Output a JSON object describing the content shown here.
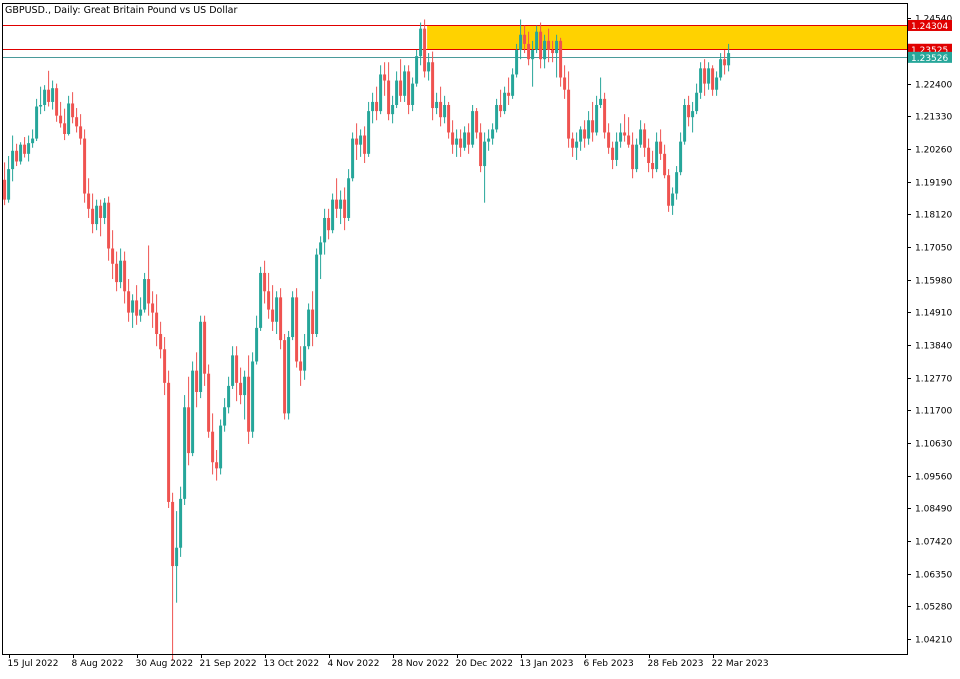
{
  "header": {
    "symbol": "GBPUSD.",
    "timeframe": "Daily",
    "description": "Great Britain Pound vs US Dollar"
  },
  "chart_data": {
    "type": "candlestick",
    "symbol": "GBPUSD.",
    "timeframe": "Daily",
    "ylim": [
      1.0372,
      1.2504
    ],
    "y_ticks": [
      "1.24540",
      "1.22400",
      "1.21330",
      "1.20260",
      "1.19190",
      "1.18120",
      "1.17050",
      "1.15980",
      "1.14910",
      "1.13840",
      "1.12770",
      "1.11700",
      "1.10630",
      "1.09560",
      "1.08490",
      "1.07420",
      "1.06350",
      "1.05280",
      "1.04210"
    ],
    "x_tick_labels": [
      "15 Jul 2022",
      "8 Aug 2022",
      "30 Aug 2022",
      "21 Sep 2022",
      "13 Oct 2022",
      "4 Nov 2022",
      "28 Nov 2022",
      "20 Dec 2022",
      "13 Jan 2023",
      "6 Feb 2023",
      "28 Feb 2023",
      "22 Mar 2023"
    ],
    "x_tick_index": [
      1,
      17,
      33,
      49,
      65,
      81,
      97,
      113,
      129,
      145,
      161,
      177
    ],
    "up_color": "#26a69a",
    "down_color": "#ef5350",
    "grid": false,
    "price_labels": [
      {
        "text": "1.24304",
        "value": 1.24304,
        "bg": "#e00000",
        "fg": "#ffffff"
      },
      {
        "text": "1.23525",
        "value": 1.23525,
        "bg": "#e00000",
        "fg": "#ffffff"
      },
      {
        "text": "1.23526",
        "value": 1.2326,
        "bg": "#26a69a",
        "fg": "#ffffff"
      }
    ],
    "horizontal_lines": [
      {
        "value": 1.24304,
        "color": "#e00000"
      },
      {
        "value": 1.23525,
        "color": "#e00000"
      },
      {
        "value": 1.2326,
        "color": "#4a9a9a"
      }
    ],
    "zone": {
      "from_index": 106,
      "y_top": 1.24304,
      "y_bottom": 1.23525,
      "color": "#ffd200"
    },
    "candles": [
      [
        1.1925,
        1.1982,
        1.1842,
        1.186
      ],
      [
        1.186,
        1.2003,
        1.185,
        1.196
      ],
      [
        1.196,
        1.207,
        1.192,
        1.202
      ],
      [
        1.202,
        1.2043,
        1.197,
        1.1985
      ],
      [
        1.1985,
        1.2048,
        1.1975,
        1.204
      ],
      [
        1.204,
        1.2065,
        1.1998,
        1.201
      ],
      [
        1.201,
        1.207,
        1.1985,
        1.2045
      ],
      [
        1.2045,
        1.209,
        1.203,
        1.206
      ],
      [
        1.206,
        1.219,
        1.2052,
        1.2165
      ],
      [
        1.2165,
        1.223,
        1.214,
        1.217
      ],
      [
        1.217,
        1.2235,
        1.215,
        1.222
      ],
      [
        1.222,
        1.2282,
        1.2165,
        1.218
      ],
      [
        1.218,
        1.225,
        1.2155,
        1.2225
      ],
      [
        1.2225,
        1.224,
        1.2115,
        1.2135
      ],
      [
        1.2135,
        1.218,
        1.2096,
        1.211
      ],
      [
        1.211,
        1.2158,
        1.2055,
        1.2075
      ],
      [
        1.2075,
        1.22,
        1.207,
        1.2175
      ],
      [
        1.2175,
        1.2212,
        1.211,
        1.213
      ],
      [
        1.213,
        1.216,
        1.208,
        1.21
      ],
      [
        1.21,
        1.214,
        1.204,
        1.206
      ],
      [
        1.206,
        1.209,
        1.185,
        1.188
      ],
      [
        1.188,
        1.193,
        1.18,
        1.183
      ],
      [
        1.183,
        1.188,
        1.175,
        1.178
      ],
      [
        1.178,
        1.186,
        1.176,
        1.184
      ],
      [
        1.184,
        1.186,
        1.174,
        1.18
      ],
      [
        1.18,
        1.1865,
        1.178,
        1.185
      ],
      [
        1.185,
        1.187,
        1.166,
        1.17
      ],
      [
        1.17,
        1.176,
        1.16,
        1.165
      ],
      [
        1.165,
        1.169,
        1.156,
        1.159
      ],
      [
        1.159,
        1.17,
        1.157,
        1.166
      ],
      [
        1.166,
        1.169,
        1.152,
        1.156
      ],
      [
        1.156,
        1.16,
        1.146,
        1.149
      ],
      [
        1.149,
        1.155,
        1.144,
        1.153
      ],
      [
        1.153,
        1.158,
        1.145,
        1.148
      ],
      [
        1.148,
        1.154,
        1.146,
        1.15
      ],
      [
        1.15,
        1.162,
        1.149,
        1.16
      ],
      [
        1.16,
        1.171,
        1.148,
        1.152
      ],
      [
        1.152,
        1.156,
        1.144,
        1.149
      ],
      [
        1.149,
        1.155,
        1.138,
        1.142
      ],
      [
        1.142,
        1.146,
        1.134,
        1.137
      ],
      [
        1.137,
        1.141,
        1.122,
        1.126
      ],
      [
        1.126,
        1.13,
        1.085,
        1.087
      ],
      [
        1.087,
        1.09,
        1.035,
        1.066
      ],
      [
        1.066,
        1.084,
        1.054,
        1.072
      ],
      [
        1.072,
        1.092,
        1.069,
        1.088
      ],
      [
        1.088,
        1.122,
        1.086,
        1.118
      ],
      [
        1.118,
        1.128,
        1.099,
        1.103
      ],
      [
        1.103,
        1.133,
        1.102,
        1.13
      ],
      [
        1.13,
        1.136,
        1.118,
        1.123
      ],
      [
        1.123,
        1.148,
        1.121,
        1.146
      ],
      [
        1.146,
        1.148,
        1.125,
        1.129
      ],
      [
        1.129,
        1.132,
        1.108,
        1.11
      ],
      [
        1.11,
        1.116,
        1.096,
        1.1
      ],
      [
        1.1,
        1.104,
        1.094,
        1.098
      ],
      [
        1.098,
        1.114,
        1.096,
        1.112
      ],
      [
        1.112,
        1.121,
        1.11,
        1.118
      ],
      [
        1.118,
        1.128,
        1.116,
        1.125
      ],
      [
        1.125,
        1.138,
        1.124,
        1.135
      ],
      [
        1.135,
        1.138,
        1.12,
        1.126
      ],
      [
        1.126,
        1.131,
        1.119,
        1.122
      ],
      [
        1.122,
        1.13,
        1.114,
        1.128
      ],
      [
        1.128,
        1.135,
        1.106,
        1.11
      ],
      [
        1.11,
        1.136,
        1.108,
        1.133
      ],
      [
        1.133,
        1.148,
        1.132,
        1.144
      ],
      [
        1.144,
        1.164,
        1.143,
        1.162
      ],
      [
        1.162,
        1.166,
        1.152,
        1.156
      ],
      [
        1.156,
        1.162,
        1.147,
        1.15
      ],
      [
        1.15,
        1.158,
        1.143,
        1.146
      ],
      [
        1.146,
        1.156,
        1.142,
        1.154
      ],
      [
        1.154,
        1.157,
        1.137,
        1.14
      ],
      [
        1.14,
        1.142,
        1.114,
        1.116
      ],
      [
        1.116,
        1.143,
        1.114,
        1.141
      ],
      [
        1.141,
        1.156,
        1.14,
        1.154
      ],
      [
        1.154,
        1.157,
        1.131,
        1.133
      ],
      [
        1.133,
        1.138,
        1.125,
        1.13
      ],
      [
        1.13,
        1.142,
        1.127,
        1.138
      ],
      [
        1.138,
        1.152,
        1.137,
        1.15
      ],
      [
        1.15,
        1.156,
        1.138,
        1.142
      ],
      [
        1.142,
        1.17,
        1.141,
        1.168
      ],
      [
        1.168,
        1.174,
        1.16,
        1.172
      ],
      [
        1.172,
        1.183,
        1.168,
        1.18
      ],
      [
        1.18,
        1.183,
        1.173,
        1.176
      ],
      [
        1.176,
        1.188,
        1.175,
        1.186
      ],
      [
        1.186,
        1.193,
        1.18,
        1.183
      ],
      [
        1.183,
        1.189,
        1.178,
        1.186
      ],
      [
        1.186,
        1.19,
        1.176,
        1.18
      ],
      [
        1.18,
        1.196,
        1.179,
        1.193
      ],
      [
        1.193,
        1.208,
        1.192,
        1.206
      ],
      [
        1.206,
        1.211,
        1.199,
        1.204
      ],
      [
        1.204,
        1.209,
        1.2,
        1.207
      ],
      [
        1.207,
        1.21,
        1.198,
        1.201
      ],
      [
        1.201,
        1.218,
        1.2,
        1.215
      ],
      [
        1.215,
        1.221,
        1.211,
        1.218
      ],
      [
        1.218,
        1.223,
        1.212,
        1.215
      ],
      [
        1.215,
        1.23,
        1.214,
        1.227
      ],
      [
        1.227,
        1.231,
        1.22,
        1.225
      ],
      [
        1.225,
        1.231,
        1.212,
        1.214
      ],
      [
        1.214,
        1.22,
        1.211,
        1.217
      ],
      [
        1.217,
        1.228,
        1.216,
        1.225
      ],
      [
        1.225,
        1.232,
        1.218,
        1.22
      ],
      [
        1.22,
        1.23,
        1.218,
        1.228
      ],
      [
        1.228,
        1.23,
        1.214,
        1.217
      ],
      [
        1.217,
        1.226,
        1.215,
        1.224
      ],
      [
        1.224,
        1.235,
        1.223,
        1.233
      ],
      [
        1.233,
        1.244,
        1.23,
        1.242
      ],
      [
        1.242,
        1.245,
        1.226,
        1.228
      ],
      [
        1.228,
        1.234,
        1.225,
        1.231
      ],
      [
        1.231,
        1.2345,
        1.212,
        1.216
      ],
      [
        1.216,
        1.221,
        1.214,
        1.218
      ],
      [
        1.218,
        1.223,
        1.21,
        1.213
      ],
      [
        1.213,
        1.22,
        1.211,
        1.217
      ],
      [
        1.217,
        1.218,
        1.206,
        1.208
      ],
      [
        1.208,
        1.212,
        1.201,
        1.204
      ],
      [
        1.204,
        1.209,
        1.2,
        1.206
      ],
      [
        1.206,
        1.209,
        1.2,
        1.203
      ],
      [
        1.203,
        1.21,
        1.202,
        1.208
      ],
      [
        1.208,
        1.211,
        1.201,
        1.204
      ],
      [
        1.204,
        1.217,
        1.203,
        1.215
      ],
      [
        1.215,
        1.216,
        1.206,
        1.208
      ],
      [
        1.208,
        1.211,
        1.195,
        1.197
      ],
      [
        1.197,
        1.208,
        1.185,
        1.205
      ],
      [
        1.205,
        1.209,
        1.202,
        1.206
      ],
      [
        1.206,
        1.211,
        1.204,
        1.209
      ],
      [
        1.209,
        1.219,
        1.208,
        1.217
      ],
      [
        1.217,
        1.222,
        1.213,
        1.215
      ],
      [
        1.215,
        1.223,
        1.214,
        1.221
      ],
      [
        1.221,
        1.226,
        1.217,
        1.22
      ],
      [
        1.22,
        1.229,
        1.219,
        1.227
      ],
      [
        1.227,
        1.237,
        1.226,
        1.235
      ],
      [
        1.235,
        1.245,
        1.232,
        1.24
      ],
      [
        1.24,
        1.243,
        1.234,
        1.237
      ],
      [
        1.237,
        1.241,
        1.23,
        1.232
      ],
      [
        1.232,
        1.238,
        1.223,
        1.235
      ],
      [
        1.235,
        1.243,
        1.234,
        1.241
      ],
      [
        1.241,
        1.244,
        1.229,
        1.232
      ],
      [
        1.232,
        1.24,
        1.229,
        1.238
      ],
      [
        1.238,
        1.242,
        1.231,
        1.235
      ],
      [
        1.235,
        1.238,
        1.231,
        1.234
      ],
      [
        1.234,
        1.24,
        1.226,
        1.238
      ],
      [
        1.238,
        1.239,
        1.223,
        1.226
      ],
      [
        1.226,
        1.23,
        1.219,
        1.222
      ],
      [
        1.222,
        1.228,
        1.203,
        1.206
      ],
      [
        1.206,
        1.208,
        1.2,
        1.203
      ],
      [
        1.203,
        1.208,
        1.199,
        1.205
      ],
      [
        1.205,
        1.21,
        1.202,
        1.209
      ],
      [
        1.209,
        1.212,
        1.203,
        1.206
      ],
      [
        1.206,
        1.215,
        1.204,
        1.212
      ],
      [
        1.212,
        1.218,
        1.205,
        1.208
      ],
      [
        1.208,
        1.22,
        1.207,
        1.217
      ],
      [
        1.217,
        1.226,
        1.216,
        1.219
      ],
      [
        1.219,
        1.221,
        1.206,
        1.208
      ],
      [
        1.208,
        1.211,
        1.201,
        1.203
      ],
      [
        1.203,
        1.205,
        1.196,
        1.199
      ],
      [
        1.199,
        1.208,
        1.197,
        1.205
      ],
      [
        1.205,
        1.211,
        1.203,
        1.208
      ],
      [
        1.208,
        1.214,
        1.205,
        1.207
      ],
      [
        1.207,
        1.213,
        1.203,
        1.204
      ],
      [
        1.204,
        1.208,
        1.193,
        1.196
      ],
      [
        1.196,
        1.206,
        1.195,
        1.204
      ],
      [
        1.204,
        1.212,
        1.203,
        1.209
      ],
      [
        1.209,
        1.211,
        1.2,
        1.203
      ],
      [
        1.203,
        1.206,
        1.195,
        1.198
      ],
      [
        1.198,
        1.202,
        1.193,
        1.196
      ],
      [
        1.196,
        1.208,
        1.195,
        1.205
      ],
      [
        1.205,
        1.209,
        1.199,
        1.201
      ],
      [
        1.201,
        1.204,
        1.193,
        1.194
      ],
      [
        1.194,
        1.196,
        1.182,
        1.184
      ],
      [
        1.184,
        1.19,
        1.181,
        1.188
      ],
      [
        1.188,
        1.197,
        1.186,
        1.195
      ],
      [
        1.195,
        1.208,
        1.194,
        1.205
      ],
      [
        1.205,
        1.219,
        1.204,
        1.217
      ],
      [
        1.217,
        1.22,
        1.21,
        1.213
      ],
      [
        1.213,
        1.218,
        1.208,
        1.215
      ],
      [
        1.215,
        1.224,
        1.214,
        1.221
      ],
      [
        1.221,
        1.231,
        1.219,
        1.229
      ],
      [
        1.229,
        1.232,
        1.22,
        1.224
      ],
      [
        1.224,
        1.231,
        1.222,
        1.229
      ],
      [
        1.229,
        1.23,
        1.22,
        1.222
      ],
      [
        1.222,
        1.228,
        1.22,
        1.226
      ],
      [
        1.226,
        1.234,
        1.225,
        1.232
      ],
      [
        1.232,
        1.235,
        1.227,
        1.23
      ],
      [
        1.23,
        1.237,
        1.228,
        1.234
      ]
    ]
  }
}
